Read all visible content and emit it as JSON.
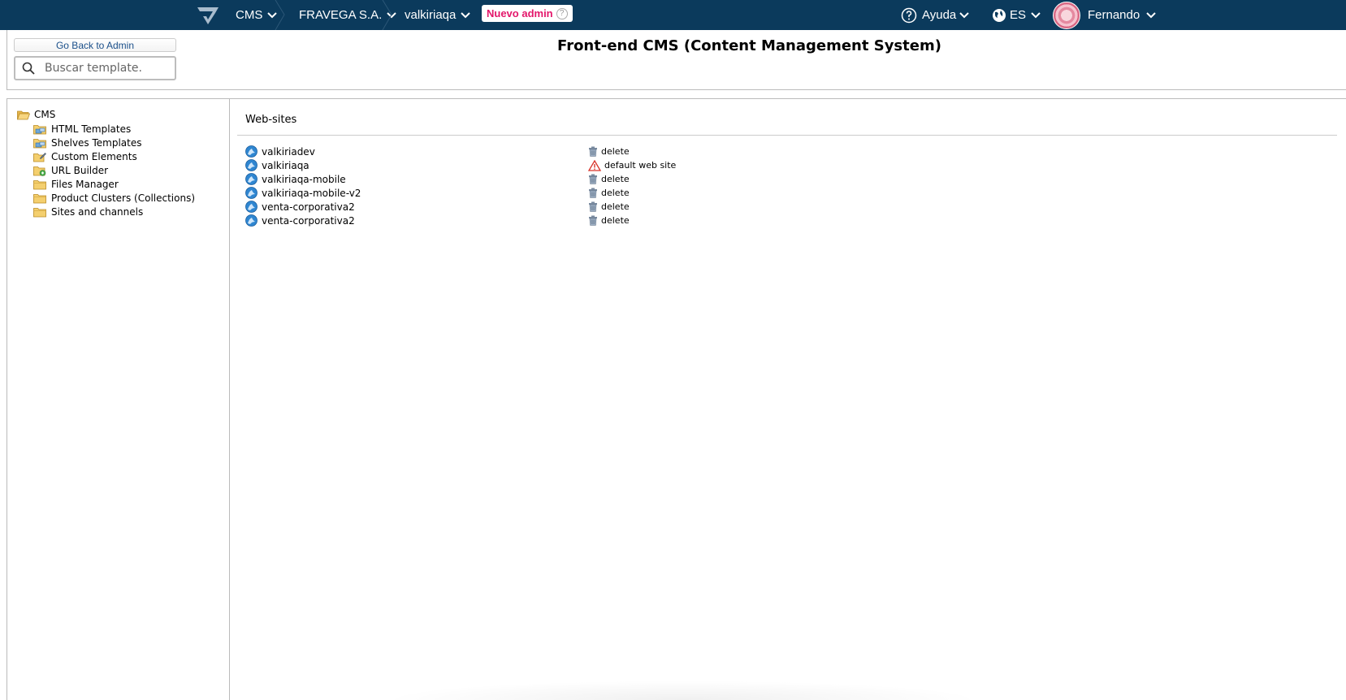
{
  "topbar": {
    "crumbs": [
      "CMS",
      "FRAVEGA S.A.",
      "valkiriaqa"
    ],
    "badge": "Nuevo admin",
    "help": "Ayuda",
    "lang": "ES",
    "user": "Fernando",
    "colors": {
      "bar": "#0b3a5c",
      "badge_text": "#e3176b"
    }
  },
  "header": {
    "back_label": "Go Back to Admin",
    "search_placeholder": "Buscar template.",
    "title": "Front-end CMS (Content Management System)"
  },
  "tree": {
    "root": "CMS",
    "items": [
      {
        "label": "HTML Templates",
        "icon": "folder-templates-icon"
      },
      {
        "label": "Shelves Templates",
        "icon": "folder-templates-icon"
      },
      {
        "label": "Custom Elements",
        "icon": "folder-edit-icon"
      },
      {
        "label": "URL Builder",
        "icon": "folder-add-icon"
      },
      {
        "label": "Files Manager",
        "icon": "folder-icon"
      },
      {
        "label": "Product Clusters (Collections)",
        "icon": "folder-icon"
      },
      {
        "label": "Sites and channels",
        "icon": "folder-icon"
      }
    ]
  },
  "websites": {
    "title": "Web-sites",
    "rows": [
      {
        "name": "valkiriadev",
        "action": "delete",
        "action_icon": "trash-icon"
      },
      {
        "name": "valkiriaqa",
        "action": "default web site",
        "action_icon": "warning-icon"
      },
      {
        "name": "valkiriaqa-mobile",
        "action": "delete",
        "action_icon": "trash-icon"
      },
      {
        "name": "valkiriaqa-mobile-v2",
        "action": "delete",
        "action_icon": "trash-icon"
      },
      {
        "name": "venta-corporativa2",
        "action": "delete",
        "action_icon": "trash-icon"
      },
      {
        "name": "venta-corporativa2",
        "action": "delete",
        "action_icon": "trash-icon"
      }
    ]
  }
}
